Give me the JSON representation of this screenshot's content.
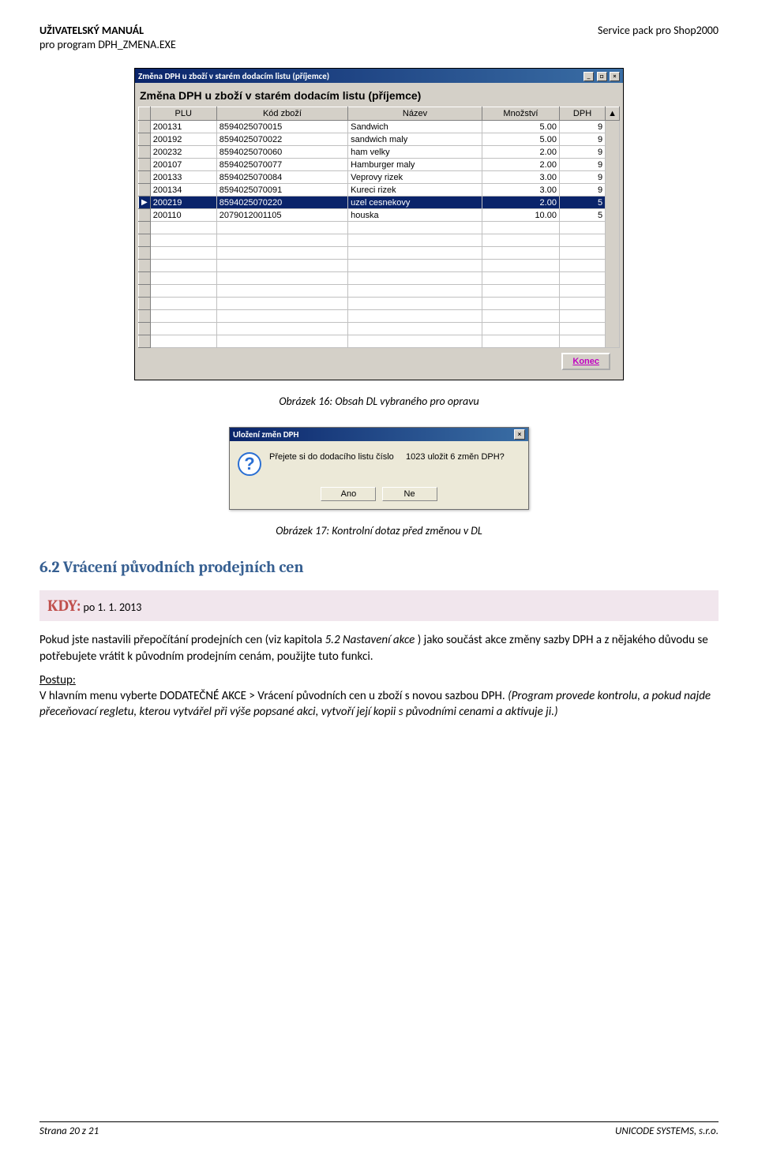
{
  "header": {
    "title_bold": "UŽIVATELSKÝ MANUÁL",
    "title_sub": "pro program DPH_ZMENA.EXE",
    "right": "Service pack pro Shop2000"
  },
  "window1": {
    "titlebar": "Změna DPH u zboží v starém dodacím listu (příjemce)",
    "panel_title": "Změna DPH u zboží v starém dodacím listu (příjemce)",
    "columns": [
      "PLU",
      "Kód zboží",
      "Název",
      "Množství",
      "DPH"
    ],
    "rows": [
      {
        "plu": "200131",
        "kod": "8594025070015",
        "nazev": "Sandwich",
        "mn": "5.00",
        "dph": "9",
        "sel": false
      },
      {
        "plu": "200192",
        "kod": "8594025070022",
        "nazev": "sandwich maly",
        "mn": "5.00",
        "dph": "9",
        "sel": false
      },
      {
        "plu": "200232",
        "kod": "8594025070060",
        "nazev": "ham velky",
        "mn": "2.00",
        "dph": "9",
        "sel": false
      },
      {
        "plu": "200107",
        "kod": "8594025070077",
        "nazev": "Hamburger maly",
        "mn": "2.00",
        "dph": "9",
        "sel": false
      },
      {
        "plu": "200133",
        "kod": "8594025070084",
        "nazev": "Veprovy rizek",
        "mn": "3.00",
        "dph": "9",
        "sel": false
      },
      {
        "plu": "200134",
        "kod": "8594025070091",
        "nazev": "Kureci rizek",
        "mn": "3.00",
        "dph": "9",
        "sel": false
      },
      {
        "plu": "200219",
        "kod": "8594025070220",
        "nazev": "uzel cesnekovy",
        "mn": "2.00",
        "dph": "5",
        "sel": true
      },
      {
        "plu": "200110",
        "kod": "2079012001105",
        "nazev": "houska",
        "mn": "10.00",
        "dph": "5",
        "sel": false
      }
    ],
    "empty_rows": 10,
    "button": "Konec"
  },
  "caption1": "Obrázek 16: Obsah DL vybraného pro opravu",
  "dialog": {
    "title": "Uložení změn DPH",
    "message_pre": "Přejete si do dodacího listu číslo",
    "message_num": "1023 uložit 6 změn DPH?",
    "btn_yes": "Ano",
    "btn_no": "Ne"
  },
  "caption2": "Obrázek 17: Kontrolní dotaz před změnou v DL",
  "section": {
    "heading": "6.2 Vrácení původních prodejních cen",
    "kdy_label": "KDY:",
    "kdy_text": " po 1. 1. 2013",
    "p1a": "Pokud jste nastavili přepočítání prodejních cen (viz kapitola ",
    "p1b": "5.2 Nastavení akce ",
    "p1c": ") jako součást akce změny sazby DPH a z nějakého důvodu se potřebujete vrátit k původním prodejním cenám, použijte tuto funkci.",
    "p2_label": "Postup:",
    "p2a": "V hlavním menu vyberte ",
    "p2_menu": "DODATEČNÉ AKCE > Vrácení původních cen u zboží s novou sazbou DPH",
    "p2b": ". ",
    "p2c": "(Program provede kontrolu, a pokud najde přeceňovací regletu, kterou vytvářel při výše popsané akci, vytvoří její kopii s původními cenami a aktivuje ji.)"
  },
  "footer": {
    "left": "Strana 20 z 21",
    "right": "UNICODE SYSTEMS, s.r.o."
  }
}
